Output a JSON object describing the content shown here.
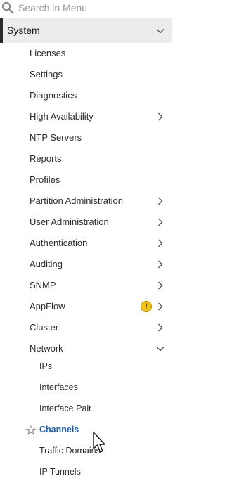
{
  "search": {
    "placeholder": "Search in Menu"
  },
  "section": {
    "label": "System"
  },
  "items": [
    {
      "label": "Licenses"
    },
    {
      "label": "Settings"
    },
    {
      "label": "Diagnostics"
    },
    {
      "label": "High Availability"
    },
    {
      "label": "NTP Servers"
    },
    {
      "label": "Reports"
    },
    {
      "label": "Profiles"
    },
    {
      "label": "Partition Administration"
    },
    {
      "label": "User Administration"
    },
    {
      "label": "Authentication"
    },
    {
      "label": "Auditing"
    },
    {
      "label": "SNMP"
    },
    {
      "label": "AppFlow",
      "warning": "!"
    },
    {
      "label": "Cluster"
    },
    {
      "label": "Network"
    }
  ],
  "network_items": [
    {
      "label": "IPs"
    },
    {
      "label": "Interfaces"
    },
    {
      "label": "Interface Pair"
    },
    {
      "label": "Channels"
    },
    {
      "label": "Traffic Domains"
    },
    {
      "label": "IP Tunnels"
    }
  ],
  "colors": {
    "active_text": "#1f5fa6",
    "warning": "#f3c315",
    "header_bg": "#ececec"
  }
}
